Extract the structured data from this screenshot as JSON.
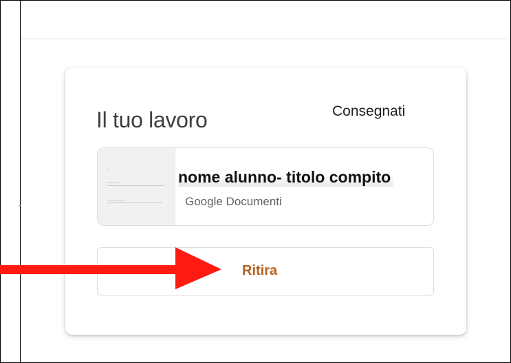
{
  "colors": {
    "accent_orange": "#b5601c",
    "annotation_arrow": "#ff1a12",
    "title_text": "#3c4043",
    "secondary_text": "#5f6368"
  },
  "card": {
    "title": "Il tuo lavoro",
    "status": "Consegnati",
    "attachment": {
      "title": "nome alunno- titolo compito",
      "type": "Google Documenti",
      "thumbnail_icon": "document-thumbnail"
    },
    "unsubmit_label": "Ritira"
  },
  "annotation": {
    "icon": "red-arrow-pointing-right"
  }
}
